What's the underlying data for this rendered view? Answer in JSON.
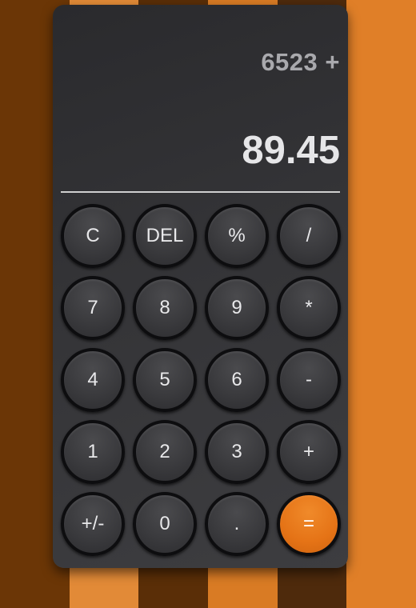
{
  "background": {
    "stripe_colors": [
      "#6b3606",
      "#e28a37",
      "#5a2e07",
      "#d97b24",
      "#4e2a0c",
      "#e07f28"
    ]
  },
  "display": {
    "expression": "6523 +",
    "result": "89.45"
  },
  "keypad": {
    "rows": [
      [
        {
          "label": "C",
          "name": "clear-button"
        },
        {
          "label": "DEL",
          "name": "delete-button"
        },
        {
          "label": "%",
          "name": "percent-button"
        },
        {
          "label": "/",
          "name": "divide-button"
        }
      ],
      [
        {
          "label": "7",
          "name": "digit-7-button"
        },
        {
          "label": "8",
          "name": "digit-8-button"
        },
        {
          "label": "9",
          "name": "digit-9-button"
        },
        {
          "label": "*",
          "name": "multiply-button"
        }
      ],
      [
        {
          "label": "4",
          "name": "digit-4-button"
        },
        {
          "label": "5",
          "name": "digit-5-button"
        },
        {
          "label": "6",
          "name": "digit-6-button"
        },
        {
          "label": "-",
          "name": "subtract-button"
        }
      ],
      [
        {
          "label": "1",
          "name": "digit-1-button"
        },
        {
          "label": "2",
          "name": "digit-2-button"
        },
        {
          "label": "3",
          "name": "digit-3-button"
        },
        {
          "label": "+",
          "name": "add-button"
        }
      ],
      [
        {
          "label": "+/-",
          "name": "toggle-sign-button"
        },
        {
          "label": "0",
          "name": "digit-0-button"
        },
        {
          "label": ".",
          "name": "decimal-button"
        },
        {
          "label": "=",
          "name": "equals-button"
        }
      ]
    ],
    "accent_color": "#e57316"
  }
}
